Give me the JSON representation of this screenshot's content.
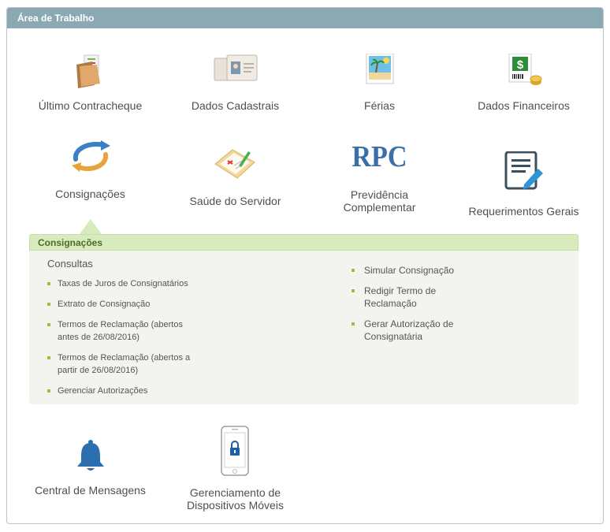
{
  "panel": {
    "title": "Área de Trabalho"
  },
  "tiles": {
    "contracheque": {
      "label": "Último Contracheque",
      "icon": "folder-icon"
    },
    "cadastrais": {
      "label": "Dados Cadastrais",
      "icon": "id-cards-icon"
    },
    "ferias": {
      "label": "Férias",
      "icon": "beach-postcard-icon"
    },
    "financeiros": {
      "label": "Dados Financeiros",
      "icon": "money-document-icon"
    },
    "consignacoes": {
      "label": "Consignações",
      "icon": "circular-arrows-icon"
    },
    "saude": {
      "label": "Saúde do Servidor",
      "icon": "medical-form-icon"
    },
    "previdencia": {
      "label_line1": "Previdência",
      "label_line2": "Complementar",
      "icon_text": "RPC"
    },
    "requerimentos": {
      "label": "Requerimentos Gerais",
      "icon": "document-edit-icon"
    },
    "mensagens": {
      "label": "Central de Mensagens",
      "icon": "bell-icon"
    },
    "dispositivos": {
      "label_line1": "Gerenciamento de",
      "label_line2": "Dispositivos Móveis",
      "icon": "phone-lock-icon"
    }
  },
  "submenu": {
    "title": "Consignações",
    "consultas_title": "Consultas",
    "consultas": [
      {
        "line1": "Taxas de Juros de Consignatários",
        "line2": ""
      },
      {
        "line1": "Extrato de Consignação",
        "line2": ""
      },
      {
        "line1": "Termos de Reclamação (abertos",
        "line2": "antes de 26/08/2016)"
      },
      {
        "line1": "Termos de Reclamação (abertos a",
        "line2": "partir de 26/08/2016)"
      },
      {
        "line1": "Gerenciar Autorizações",
        "line2": ""
      }
    ],
    "acoes": [
      {
        "line1": "Simular Consignação",
        "line2": ""
      },
      {
        "line1": "Redigir Termo de",
        "line2": "Reclamação"
      },
      {
        "line1": "Gerar Autorização de",
        "line2": "Consignatária"
      }
    ]
  },
  "colors": {
    "header_bg": "#8aa9b3",
    "submenu_header_bg": "#d8ebbc",
    "bullet": "#9bbf4f",
    "rpc_blue": "#3a6fa8",
    "bell_blue": "#2c6fae"
  }
}
